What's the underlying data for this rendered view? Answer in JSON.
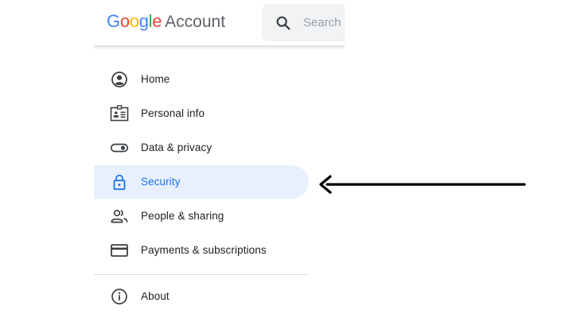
{
  "header": {
    "logo_google": [
      "G",
      "o",
      "o",
      "g",
      "l",
      "e"
    ],
    "logo_colors": [
      "#4285F4",
      "#EA4335",
      "#FBBC05",
      "#4285F4",
      "#34A853",
      "#EA4335"
    ],
    "logo_account": "Account",
    "search": {
      "icon": "search-icon",
      "placeholder": "Search Google Account"
    }
  },
  "sidebar": {
    "items": [
      {
        "label": "Home",
        "icon": "home-account-icon",
        "active": false
      },
      {
        "label": "Personal info",
        "icon": "id-card-icon",
        "active": false
      },
      {
        "label": "Data & privacy",
        "icon": "toggle-icon",
        "active": false
      },
      {
        "label": "Security",
        "icon": "lock-icon",
        "active": true
      },
      {
        "label": "People & sharing",
        "icon": "people-icon",
        "active": false
      },
      {
        "label": "Payments & subscriptions",
        "icon": "credit-card-icon",
        "active": false
      },
      {
        "label": "About",
        "icon": "info-icon",
        "active": false
      }
    ]
  },
  "annotation": {
    "icon": "left-arrow-icon",
    "color": "#000000"
  },
  "colors": {
    "active_bg": "#e8f0fe",
    "active_text": "#1a73e8",
    "icon_gray": "#3c4043"
  }
}
